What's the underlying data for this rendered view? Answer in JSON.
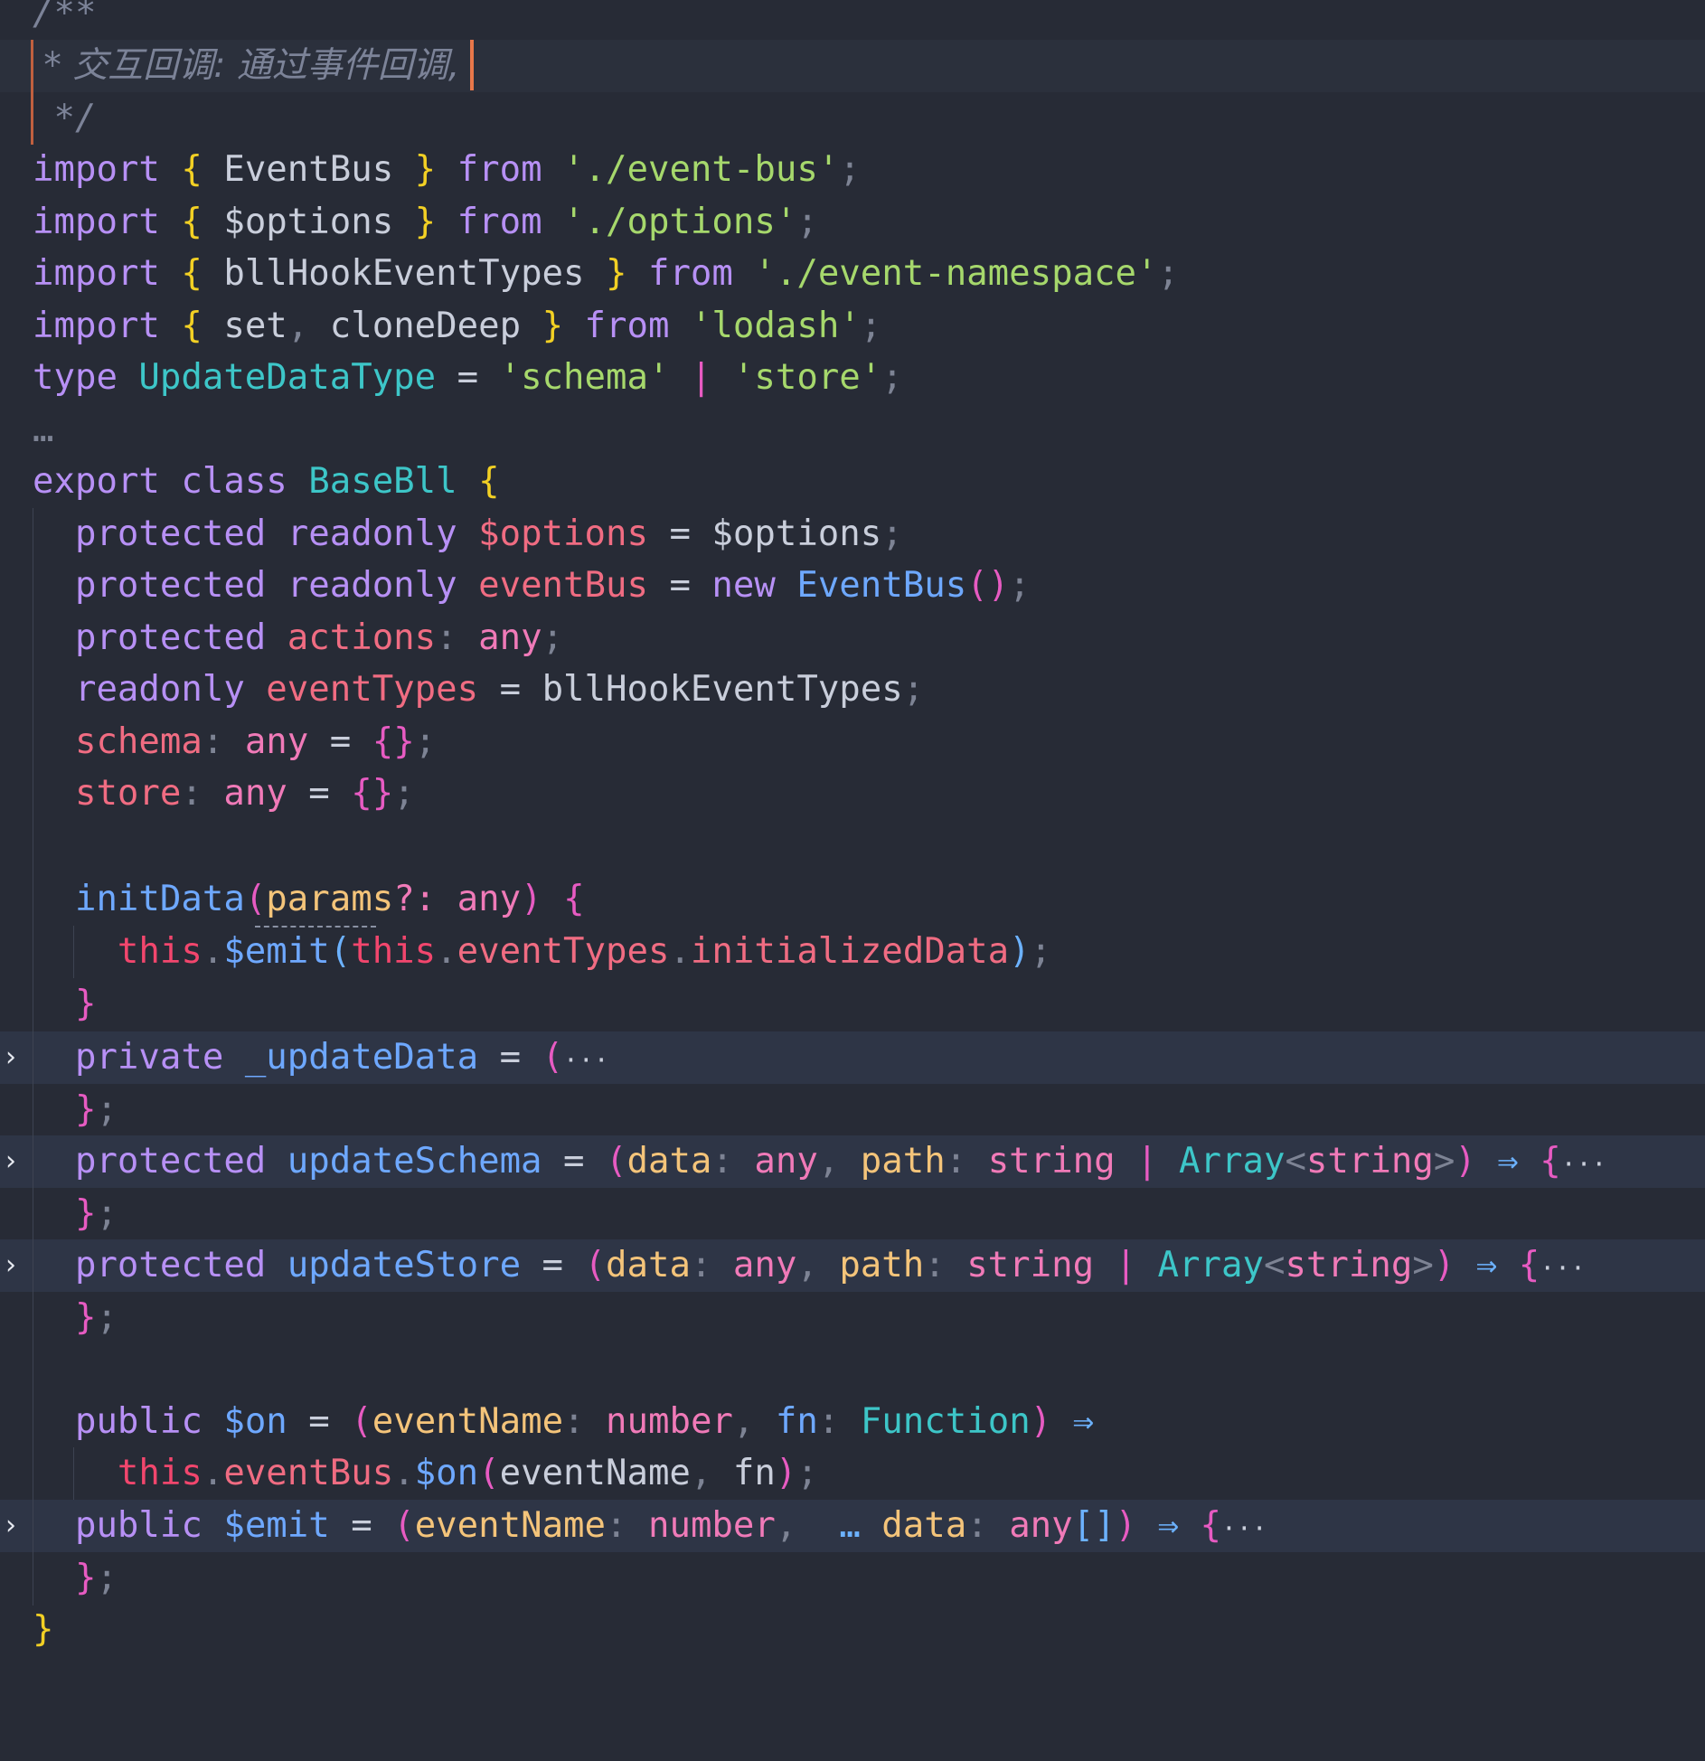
{
  "editor": {
    "language": "TypeScript",
    "comment": {
      "open": "/**",
      "line": " * 交互回调: 通过事件回调,",
      "close": " */"
    },
    "imports": [
      {
        "kw": "import",
        "name": "EventBus",
        "from": "from",
        "path": "'./event-bus'"
      },
      {
        "kw": "import",
        "name": "$options",
        "from": "from",
        "path": "'./options'"
      },
      {
        "kw": "import",
        "name": "bllHookEventTypes",
        "from": "from",
        "path": "'./event-namespace'"
      }
    ],
    "lodash_import": {
      "kw": "import",
      "name1": "set",
      "name2": "cloneDeep",
      "from": "from",
      "path": "'lodash'"
    },
    "type_decl": {
      "kw": "type",
      "name": "UpdateDataType",
      "val1": "'schema'",
      "val2": "'store'"
    },
    "folded_ellipsis": "…",
    "class_decl": {
      "kw1": "export",
      "kw2": "class",
      "name": "BaseBll"
    },
    "members": {
      "options": {
        "mod1": "protected",
        "mod2": "readonly",
        "name": "$options",
        "value": "$options"
      },
      "event_bus": {
        "mod1": "protected",
        "mod2": "readonly",
        "name": "eventBus",
        "new_kw": "new",
        "ctor": "EventBus"
      },
      "actions": {
        "mod1": "protected",
        "name": "actions",
        "type": "any"
      },
      "event_types": {
        "mod1": "readonly",
        "name": "eventTypes",
        "value": "bllHookEventTypes"
      },
      "schema": {
        "name": "schema",
        "type": "any"
      },
      "store": {
        "name": "store",
        "type": "any"
      }
    },
    "init_data": {
      "name": "initData",
      "param": "params",
      "param_type": "any",
      "this_kw": "this",
      "call": "$emit",
      "arg_obj": "eventTypes",
      "arg_prop": "initializedData"
    },
    "update_data": {
      "mod": "private",
      "name": "_updateData"
    },
    "update_schema": {
      "mod": "protected",
      "name": "updateSchema",
      "p1": "data",
      "t1": "any",
      "p2": "path",
      "t2": "string",
      "generic": "Array",
      "t3": "string"
    },
    "update_store": {
      "mod": "protected",
      "name": "updateStore",
      "p1": "data",
      "t1": "any",
      "p2": "path",
      "t2": "string",
      "generic": "Array",
      "t3": "string"
    },
    "on_method": {
      "mod": "public",
      "name": "$on",
      "p1": "eventName",
      "t1": "number",
      "p2": "fn",
      "t2": "Function",
      "this_kw": "this",
      "bus": "eventBus",
      "call": "$on",
      "a1": "eventName",
      "a2": "fn"
    },
    "emit_method": {
      "mod": "public",
      "name": "$emit",
      "p1": "eventName",
      "t1": "number",
      "spread": "…",
      "p2": "data",
      "t2": "any"
    },
    "fold_arrow": "›",
    "colors": {
      "background": "#272b36",
      "keyword": "#b790f5",
      "string": "#a6d86c",
      "type": "#3dc6c8",
      "property": "#f06c82",
      "function": "#6ea8ff",
      "this": "#f2466d",
      "caret": "#e8774a"
    }
  }
}
